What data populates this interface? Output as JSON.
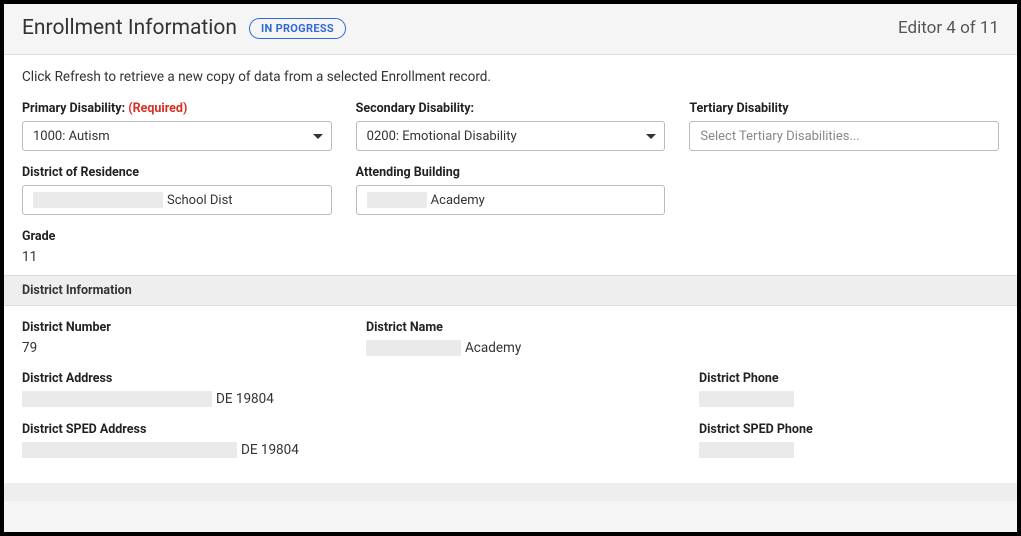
{
  "header": {
    "title": "Enrollment Information",
    "status": "IN PROGRESS",
    "editor_count": "Editor 4 of 11"
  },
  "helper_text": "Click Refresh to retrieve a new copy of data from a selected Enrollment record.",
  "fields": {
    "primary_disability": {
      "label": "Primary Disability:",
      "required_text": "(Required)",
      "value": "1000: Autism"
    },
    "secondary_disability": {
      "label": "Secondary Disability:",
      "value": "0200: Emotional Disability"
    },
    "tertiary_disability": {
      "label": "Tertiary Disability",
      "placeholder": "Select Tertiary Disabilities..."
    },
    "district_of_residence": {
      "label": "District of Residence",
      "suffix": " School Dist"
    },
    "attending_building": {
      "label": "Attending Building",
      "suffix": " Academy"
    },
    "grade": {
      "label": "Grade",
      "value": "11"
    }
  },
  "district_section": {
    "heading": "District Information",
    "number": {
      "label": "District Number",
      "value": "79"
    },
    "name": {
      "label": "District Name",
      "suffix": " Academy"
    },
    "address": {
      "label": "District Address",
      "suffix": " DE 19804"
    },
    "phone": {
      "label": "District Phone"
    },
    "sped_address": {
      "label": "District SPED Address",
      "suffix": " DE 19804"
    },
    "sped_phone": {
      "label": "District SPED Phone"
    }
  }
}
